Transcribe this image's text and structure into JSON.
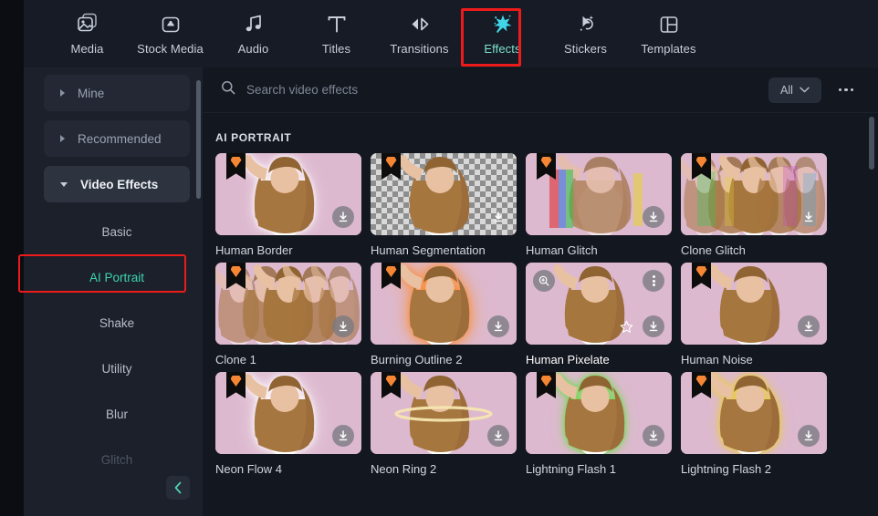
{
  "toolbar": {
    "items": [
      {
        "label": "Media",
        "icon": "media-icon",
        "active": false
      },
      {
        "label": "Stock Media",
        "icon": "stock-media-icon",
        "active": false
      },
      {
        "label": "Audio",
        "icon": "audio-note-icon",
        "active": false
      },
      {
        "label": "Titles",
        "icon": "titles-text-icon",
        "active": false
      },
      {
        "label": "Transitions",
        "icon": "transitions-icon",
        "active": false
      },
      {
        "label": "Effects",
        "icon": "effects-wand-icon",
        "active": true
      },
      {
        "label": "Stickers",
        "icon": "stickers-icon",
        "active": false
      },
      {
        "label": "Templates",
        "icon": "templates-icon",
        "active": false
      }
    ],
    "highlight_color": "#ee1b1b",
    "active_color": "#7fe3cd"
  },
  "sidebar": {
    "groups": [
      {
        "label": "Mine",
        "expanded": false,
        "caret": "chevron-right-icon"
      },
      {
        "label": "Recommended",
        "expanded": false,
        "caret": "chevron-right-icon"
      },
      {
        "label": "Video Effects",
        "expanded": true,
        "caret": "chevron-down-icon"
      }
    ],
    "subitems": [
      {
        "label": "Basic",
        "selected": false,
        "dim": false
      },
      {
        "label": "AI Portrait",
        "selected": true,
        "dim": false
      },
      {
        "label": "Shake",
        "selected": false,
        "dim": false
      },
      {
        "label": "Utility",
        "selected": false,
        "dim": false
      },
      {
        "label": "Blur",
        "selected": false,
        "dim": false
      },
      {
        "label": "Glitch",
        "selected": false,
        "dim": true
      }
    ],
    "selected_color": "#3fd2ae",
    "highlight_color": "#ee1b1b",
    "collapse_icon": "chevron-left-icon"
  },
  "search": {
    "placeholder": "Search video effects",
    "value": "",
    "icon": "search-icon"
  },
  "filter": {
    "label": "All",
    "caret_icon": "chevron-down-icon",
    "more_icon": "more-horizontal-icon"
  },
  "section": {
    "title": "AI PORTRAIT"
  },
  "effects": [
    {
      "name": "Human Border",
      "style": "border",
      "pro": true,
      "hovered": false,
      "download": true
    },
    {
      "name": "Human Segmentation",
      "style": "checker",
      "pro": true,
      "hovered": false,
      "download": true
    },
    {
      "name": "Human Glitch",
      "style": "glitch",
      "pro": true,
      "hovered": false,
      "download": true
    },
    {
      "name": "Clone Glitch",
      "style": "clone-glitch",
      "pro": true,
      "hovered": false,
      "download": true
    },
    {
      "name": "Clone 1",
      "style": "clone",
      "pro": true,
      "hovered": false,
      "download": true
    },
    {
      "name": "Burning Outline 2",
      "style": "burning",
      "pro": true,
      "hovered": false,
      "download": true
    },
    {
      "name": "Human Pixelate",
      "style": "plain",
      "pro": false,
      "hovered": true,
      "download": true
    },
    {
      "name": "Human Noise",
      "style": "plain",
      "pro": true,
      "hovered": false,
      "download": true
    },
    {
      "name": "Neon Flow 4",
      "style": "neon-white",
      "pro": true,
      "hovered": false,
      "download": true
    },
    {
      "name": "Neon Ring 2",
      "style": "neon-ring",
      "pro": true,
      "hovered": false,
      "download": true
    },
    {
      "name": "Lightning Flash 1",
      "style": "neon-green",
      "pro": true,
      "hovered": false,
      "download": true
    },
    {
      "name": "Lightning Flash 2",
      "style": "neon-yellow",
      "pro": true,
      "hovered": false,
      "download": true
    }
  ],
  "card_icons": {
    "download": "download-icon",
    "favorite": "star-icon",
    "preview": "magnifier-icon",
    "kebab": "more-vertical-icon",
    "pro_badge": "pro-diamond-badge-icon"
  }
}
